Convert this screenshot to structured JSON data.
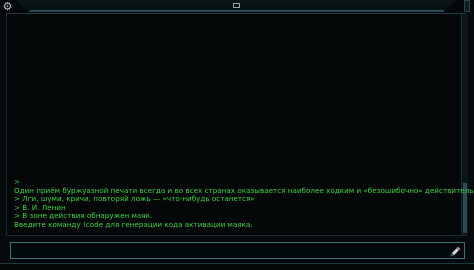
{
  "toolbar": {
    "settings_icon": "gear-icon",
    "center_icon": "window-icon"
  },
  "console": {
    "lines": [
      ">",
      "Один приём буржуазной печати всегда и во всех странах оказывается наиболее ходким и «безошибочно» действительным.",
      "> Лги, шуми, кричи, повторяй ложь — «что-нибудь останется»",
      "> В. И. Ленин",
      "> В зоне действия обнаружен маяк.",
      "Введите команду !code для генерации кода активации маяка."
    ]
  },
  "input": {
    "value": "",
    "placeholder": "",
    "submit_icon": "pen-icon"
  },
  "colors": {
    "text": "#3ed43e",
    "frame": "#3f6f78",
    "background": "#050b0d"
  }
}
